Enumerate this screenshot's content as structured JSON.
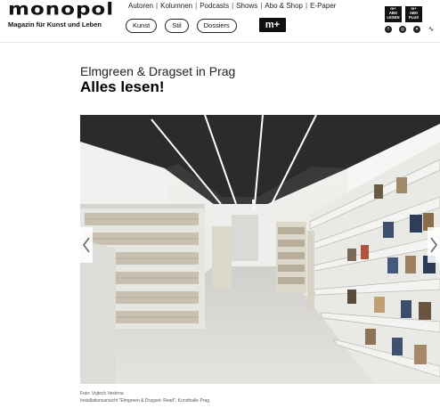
{
  "header": {
    "logo": "monopol",
    "tagline": "Magazin für Kunst und Leben",
    "nav": [
      "Autoren",
      "Kolumnen",
      "Podcasts",
      "Shows",
      "Abo & Shop",
      "E-Paper"
    ],
    "nav_separator": "|",
    "pills": [
      "Kunst",
      "Stil",
      "Dossiers"
    ],
    "mplus": "m+",
    "badges": [
      {
        "line1": "m+",
        "line2": "ABO",
        "line3": "LESEN"
      },
      {
        "line1": "m+",
        "line2": "ABO",
        "line3": "PLUS"
      }
    ],
    "social_icons": [
      "facebook-icon",
      "instagram-icon",
      "twitter-icon",
      "rss-icon"
    ]
  },
  "article": {
    "kicker": "Elmgreen & Dragset in Prag",
    "headline": "Alles lesen!",
    "gallery": {
      "prev_icon": "chevron-left-icon",
      "next_icon": "chevron-right-icon",
      "image": "bookshelf-installation-photo"
    },
    "caption": {
      "credit": "Foto: Vojtech Veskrna",
      "text": "Installationsansicht \"Elmgreen & Dragset: Read\", Kunsthalle Prag"
    }
  },
  "colors": {
    "text": "#111111",
    "background": "#ffffff",
    "accent": "#111111"
  }
}
